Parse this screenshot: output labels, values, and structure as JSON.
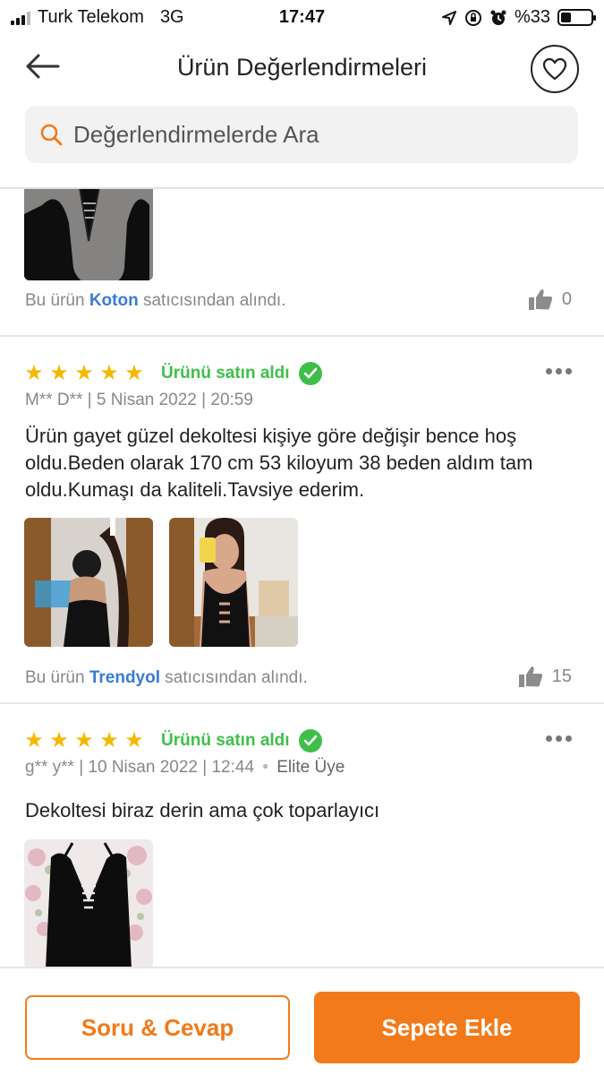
{
  "status_bar": {
    "carrier": "Turk Telekom",
    "network": "3G",
    "time": "17:47",
    "battery": "%33",
    "battery_level": 0.33
  },
  "header": {
    "title": "Ürün Değerlendirmeleri",
    "back_icon": "arrow-left-icon",
    "favorite_icon": "heart-icon"
  },
  "search": {
    "placeholder": "Değerlendirmelerde Ara",
    "icon": "search-icon"
  },
  "colors": {
    "accent": "#f27a1a",
    "verified": "#3fbf4a",
    "star": "#f5b800",
    "seller_link": "#3a7bd5"
  },
  "reviews": [
    {
      "seller_prefix": "Bu ürün",
      "seller_name": "Koton",
      "seller_suffix": "satıcısından alındı.",
      "likes": "0",
      "photos": 1
    },
    {
      "rating": 5,
      "verified_label": "Ürünü satın aldı",
      "user": "M** D**",
      "date": "5 Nisan 2022",
      "time": "20:59",
      "text": "Ürün gayet güzel dekoltesi kişiye göre değişir bence hoş oldu.Beden olarak 170 cm 53 kiloyum 38 beden aldım tam oldu.Kumaşı da kaliteli.Tavsiye ederim.",
      "photos": 2,
      "seller_prefix": "Bu ürün",
      "seller_name": "Trendyol",
      "seller_suffix": "satıcısından alındı.",
      "likes": "15"
    },
    {
      "rating": 5,
      "verified_label": "Ürünü satın aldı",
      "user": "g** y**",
      "date": "10 Nisan 2022",
      "time": "12:44",
      "badge": "Elite Üye",
      "text": "Dekoltesi biraz derin ama çok toparlayıcı",
      "photos": 1
    }
  ],
  "bottom_bar": {
    "qa_label": "Soru & Cevap",
    "cart_label": "Sepete Ekle"
  }
}
